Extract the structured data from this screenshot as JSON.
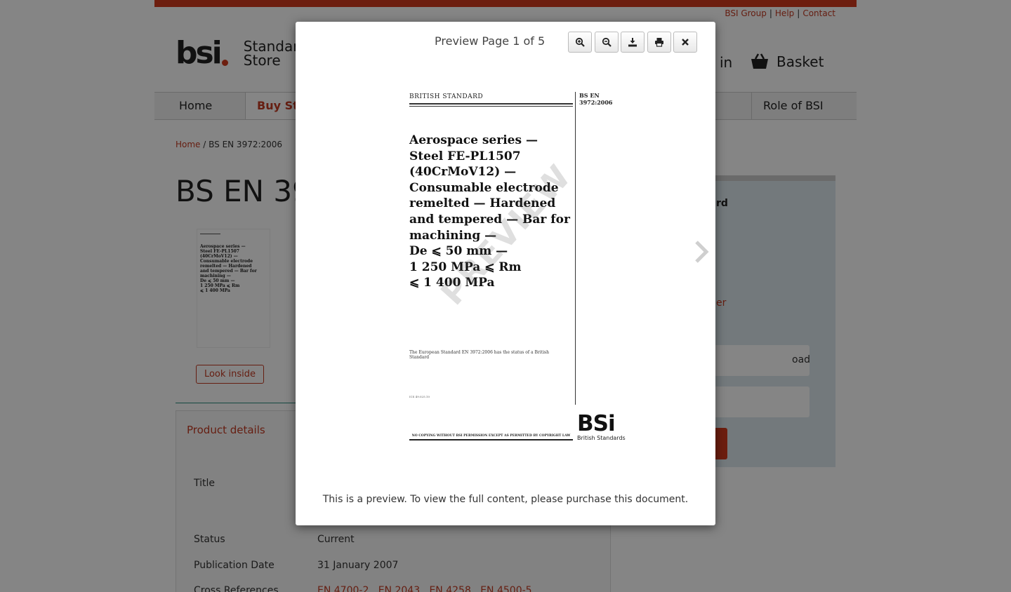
{
  "header": {
    "links": [
      "BSI Group",
      "Help",
      "Contact"
    ],
    "logo_text": "bsi",
    "logo_sub_line1": "Standards",
    "logo_sub_line2": "Store",
    "signin_label": "in",
    "basket_label": "Basket"
  },
  "nav": {
    "items": [
      "Home",
      "Buy Sta",
      "Role of BSI"
    ]
  },
  "breadcrumb": {
    "home": "Home",
    "separator": " / ",
    "current": "BS EN 3972:2006"
  },
  "page_title": "BS EN 39",
  "look_inside_label": "Look inside",
  "product_details": {
    "heading": "Product details",
    "rows": [
      {
        "label": "Title",
        "value": ""
      },
      {
        "label": "Status",
        "value": "Current"
      },
      {
        "label": "Publication Date",
        "value": "31 January 2007"
      },
      {
        "label": "Cross References",
        "value": "EN 4700-2 , EN 2043 , EN 4258 , EN 4500-5"
      }
    ]
  },
  "sidebar": {
    "label_fragment": "rd",
    "link_fragment": "er",
    "field_fragment": "oad"
  },
  "preview": {
    "title": "Preview Page 1 of 5",
    "tools": [
      "zoom-in-icon",
      "zoom-out-icon",
      "download-icon",
      "print-icon",
      "close-icon"
    ],
    "watermark": "PREVIEW",
    "note": "This is a preview. To view the full content, please purchase this document."
  },
  "document": {
    "header": "BRITISH STANDARD",
    "number_line1": "BS EN",
    "number_line2": "3972:2006",
    "title_lines": [
      "Aerospace series —",
      "Steel FE-PL1507",
      "(40CrMoV12) —",
      "Consumable electrode",
      "remelted — Hardened",
      "and tempered — Bar for",
      "machining —",
      "De ⩽ 50 mm —",
      "1 250 MPa ⩽ Rm",
      "⩽ 1 400 MPa"
    ],
    "status_text": "The European Standard EN 3972:2006 has the status of a British Standard",
    "ics": "ICS 49.025.10",
    "footer": "NO COPYING WITHOUT BSI PERMISSION EXCEPT AS PERMITTED BY COPYRIGHT LAW",
    "logo_big": "BSi",
    "logo_small": "British Standards"
  },
  "colors": {
    "brand_red": "#d23a1e",
    "link_red": "#c33a22",
    "teal_rule": "#2a8a7e",
    "sidebox_bg": "#dce9ee"
  }
}
